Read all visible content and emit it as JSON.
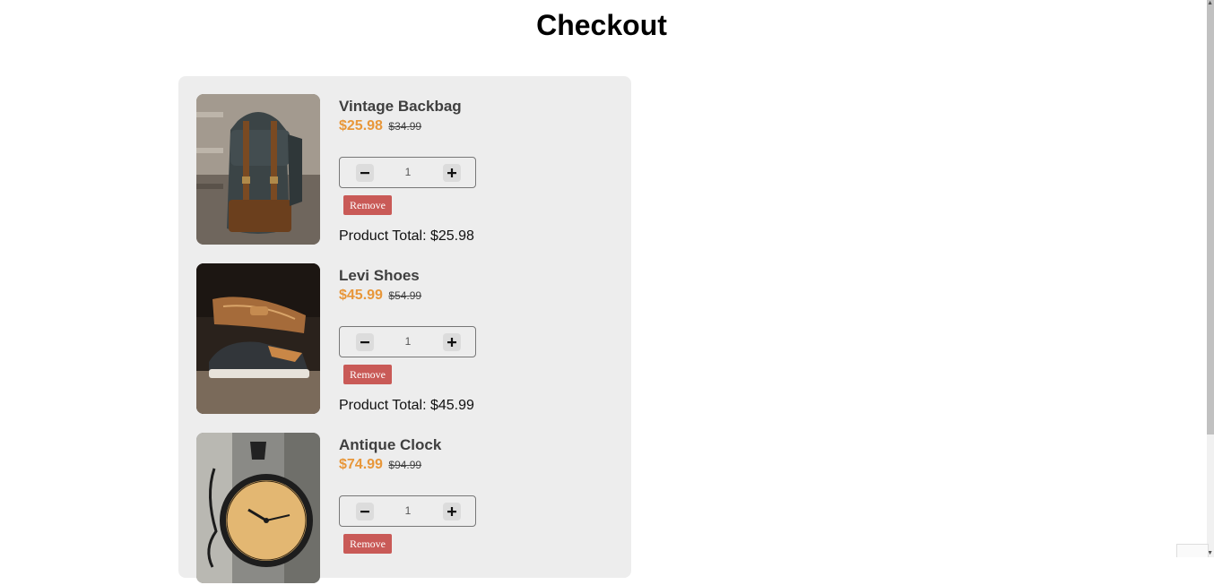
{
  "page": {
    "title": "Checkout"
  },
  "cart": {
    "items": [
      {
        "name": "Vintage Backbag",
        "price": "$25.98",
        "original_price": "$34.99",
        "quantity": "1",
        "remove_label": "Remove",
        "total": "Product Total: $25.98",
        "image_icon": "backpack-photo"
      },
      {
        "name": "Levi Shoes",
        "price": "$45.99",
        "original_price": "$54.99",
        "quantity": "1",
        "remove_label": "Remove",
        "total": "Product Total: $45.99",
        "image_icon": "shoes-photo"
      },
      {
        "name": "Antique Clock",
        "price": "$74.99",
        "original_price": "$94.99",
        "quantity": "1",
        "remove_label": "Remove",
        "total": "",
        "image_icon": "clock-photo"
      }
    ]
  },
  "colors": {
    "price": "#e8973a",
    "remove_button": "#c95a57",
    "panel_background": "#ededed"
  }
}
